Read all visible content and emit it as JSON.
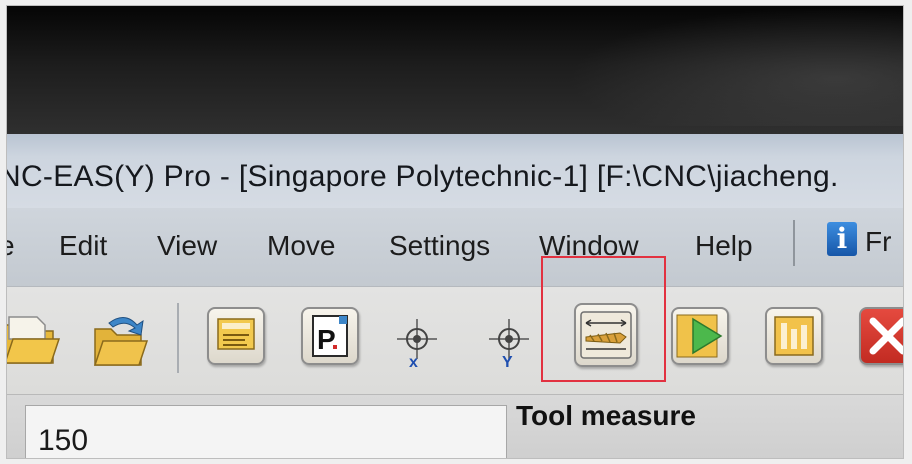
{
  "window": {
    "title": "NC-EAS(Y) Pro - [Singapore Polytechnic-1] [F:\\CNC\\jiacheng."
  },
  "menu": {
    "items": [
      "e",
      "Edit",
      "View",
      "Move",
      "Settings",
      "Window",
      "Help"
    ],
    "info_label": "Fr"
  },
  "toolbar": {
    "tools": [
      {
        "name": "open-folder",
        "icon": "folder-open-icon"
      },
      {
        "name": "import",
        "icon": "folder-import-icon"
      },
      {
        "name": "program",
        "icon": "program-icon"
      },
      {
        "name": "parameters",
        "icon": "p-parameter-icon",
        "glyph": "P"
      },
      {
        "name": "move-x",
        "icon": "crosshair-x-icon",
        "glyph": "x"
      },
      {
        "name": "move-y",
        "icon": "crosshair-y-icon",
        "glyph": "Y"
      },
      {
        "name": "tool-measure",
        "icon": "tool-measure-icon"
      },
      {
        "name": "run",
        "icon": "play-icon"
      },
      {
        "name": "tool-library",
        "icon": "tool-library-icon"
      },
      {
        "name": "stop",
        "icon": "stop-icon"
      }
    ]
  },
  "annotation": {
    "caption": "Tool measure",
    "highlight_color": "#e23140"
  },
  "status": {
    "value": "150"
  }
}
